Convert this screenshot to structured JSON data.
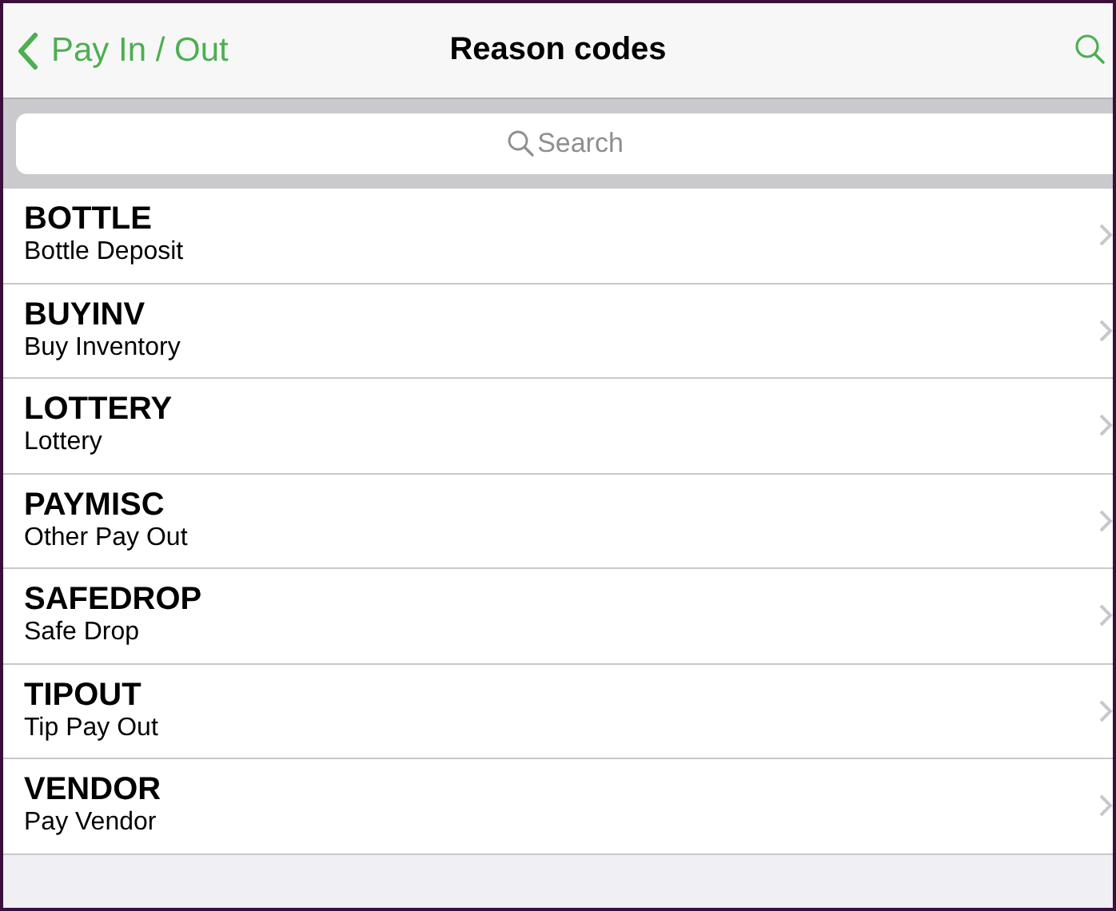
{
  "nav": {
    "back": "Pay In / Out",
    "title": "Reason codes"
  },
  "search": {
    "placeholder": "Search"
  },
  "reasons": [
    {
      "code": "BOTTLE",
      "description": "Bottle Deposit"
    },
    {
      "code": "BUYINV",
      "description": "Buy Inventory"
    },
    {
      "code": "LOTTERY",
      "description": "Lottery"
    },
    {
      "code": "PAYMISC",
      "description": "Other Pay Out"
    },
    {
      "code": "SAFEDROP",
      "description": "Safe Drop"
    },
    {
      "code": "TIPOUT",
      "description": "Tip Pay Out"
    },
    {
      "code": "VENDOR",
      "description": "Pay Vendor"
    }
  ]
}
